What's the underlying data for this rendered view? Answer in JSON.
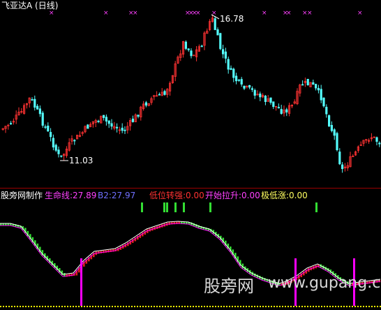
{
  "header": {
    "instrument": "飞亚达A",
    "period": "(日线)"
  },
  "price_panel": {
    "high_label": "16.78",
    "low_label": "11.03"
  },
  "indicator_bar": {
    "source": "股旁网制作",
    "life_line": "生命线:27.89",
    "b2": "B2:27.97",
    "low_turn": "低位转强:0.00",
    "start_lift": "开始拉升:0.00",
    "extreme_low": "极低涨:0.00"
  },
  "watermark": {
    "site_cn": "股旁网",
    "site_url": "www.gupang.com"
  },
  "colors": {
    "up": "#ff3232",
    "down": "#54fcfc",
    "marker": "#ff40ff",
    "green": "#33dd33",
    "white": "#ffffff",
    "yellow": "#ffff00",
    "magenta": "#ff00ff"
  }
}
